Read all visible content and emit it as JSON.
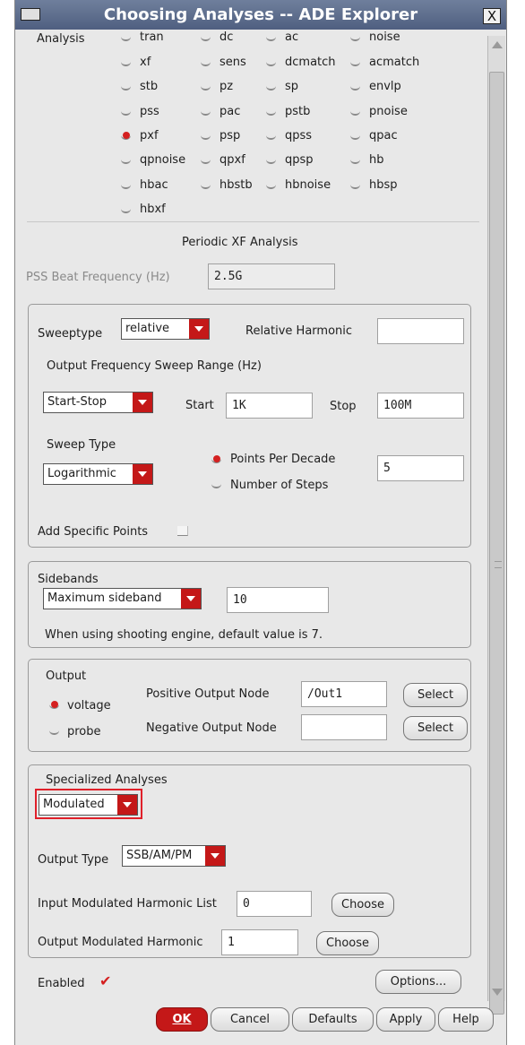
{
  "window": {
    "title": "Choosing Analyses -- ADE Explorer",
    "close_glyph": "X"
  },
  "analysis": {
    "label": "Analysis",
    "selected": "pxf",
    "options": [
      "tran",
      "dc",
      "ac",
      "noise",
      "xf",
      "sens",
      "dcmatch",
      "acmatch",
      "stb",
      "pz",
      "sp",
      "envlp",
      "pss",
      "pac",
      "pstb",
      "pnoise",
      "pxf",
      "psp",
      "qpss",
      "qpac",
      "qpnoise",
      "qpxf",
      "qpsp",
      "hb",
      "hbac",
      "hbstb",
      "hbnoise",
      "hbsp",
      "hbxf"
    ]
  },
  "section_title": "Periodic XF Analysis",
  "pss_beat": {
    "label": "PSS Beat Frequency (Hz)",
    "value": "2.5G"
  },
  "sweep": {
    "sweeptype_label": "Sweeptype",
    "sweeptype_value": "relative",
    "relative_harmonic_label": "Relative Harmonic",
    "relative_harmonic_value": "",
    "range_label": "Output Frequency Sweep Range (Hz)",
    "range_mode": "Start-Stop",
    "start_label": "Start",
    "start_value": "1K",
    "stop_label": "Stop",
    "stop_value": "100M",
    "sweep_type_label": "Sweep Type",
    "sweep_type_value": "Logarithmic",
    "points_per_decade_label": "Points Per Decade",
    "number_of_steps_label": "Number of Steps",
    "points_value": "5",
    "add_points_label": "Add Specific Points"
  },
  "sidebands": {
    "title": "Sidebands",
    "mode": "Maximum sideband",
    "value": "10",
    "note": "When using shooting engine, default value is 7."
  },
  "output": {
    "title": "Output",
    "voltage_label": "voltage",
    "probe_label": "probe",
    "pos_label": "Positive Output Node",
    "pos_value": "/Out1",
    "neg_label": "Negative Output Node",
    "neg_value": "",
    "select_label": "Select"
  },
  "specialized": {
    "title": "Specialized Analyses",
    "mode": "Modulated",
    "output_type_label": "Output Type",
    "output_type_value": "SSB/AM/PM",
    "input_list_label": "Input Modulated Harmonic List",
    "input_list_value": "0",
    "output_harm_label": "Output Modulated Harmonic",
    "output_harm_value": "1",
    "choose_label": "Choose"
  },
  "enabled_label": "Enabled",
  "options_label": "Options...",
  "buttons": {
    "ok": "OK",
    "cancel": "Cancel",
    "defaults": "Defaults",
    "apply": "Apply",
    "help": "Help"
  },
  "colors": {
    "accent": "#c41818",
    "titlebar": "#5a6a8a",
    "highlight": "#e0202a"
  }
}
